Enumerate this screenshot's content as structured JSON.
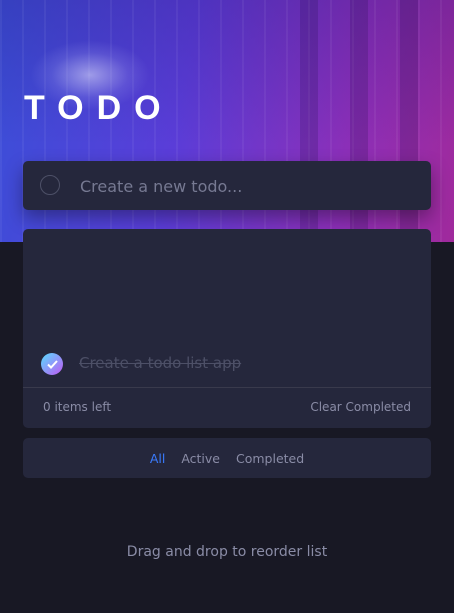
{
  "header": {
    "title": "TODO"
  },
  "new_todo": {
    "placeholder": "Create a new todo..."
  },
  "todos": [
    {
      "text": "Create a todo list app",
      "completed": true
    }
  ],
  "footer": {
    "items_left": "0 items left",
    "clear_label": "Clear Completed"
  },
  "filters": {
    "all": "All",
    "active": "Active",
    "completed": "Completed",
    "selected": "All"
  },
  "hint": "Drag and drop to reorder list",
  "colors": {
    "background": "#181824",
    "card": "#25273c",
    "accent": "#3a7bfd",
    "check_gradient_start": "#57ddff",
    "check_gradient_end": "#c058f3"
  }
}
